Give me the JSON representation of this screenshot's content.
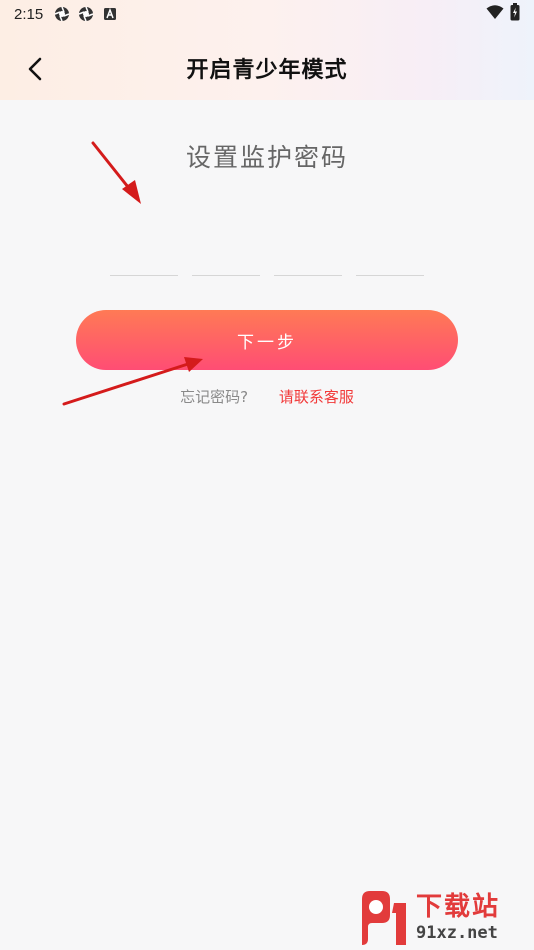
{
  "status_bar": {
    "time": "2:15",
    "left_icons": [
      "aperture-icon",
      "aperture-icon",
      "a-box-icon"
    ],
    "right_icons": [
      "wifi-icon",
      "battery-icon"
    ]
  },
  "header": {
    "title": "开启青少年模式",
    "back_icon": "chevron-left-icon"
  },
  "main": {
    "section_title": "设置监护密码",
    "pin_slots": [
      "",
      "",
      "",
      ""
    ],
    "next_button_label": "下一步",
    "forgot_label": "忘记密码?",
    "contact_link": "请联系客服"
  },
  "watermark": {
    "main": "下载站",
    "sub": "91xz.net"
  },
  "colors": {
    "accent_start": "#ff7a55",
    "accent_end": "#ff4d74",
    "link": "#f23a3a",
    "arrow": "#d41b1b"
  }
}
